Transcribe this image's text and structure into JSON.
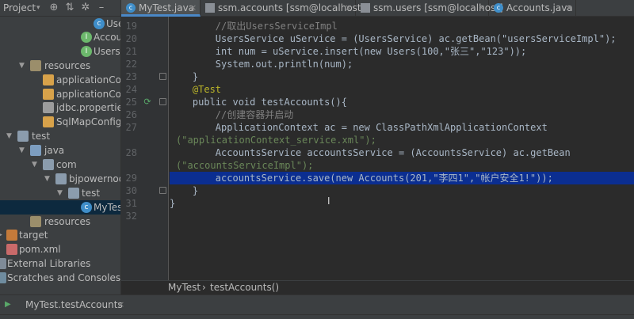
{
  "project_header": {
    "label": "Project",
    "caret": "▾"
  },
  "tree": [
    {
      "label": "Use",
      "icon": "class-icon",
      "name": "tree-item-users-class"
    },
    {
      "label": "Accoun",
      "icon": "interface-icon",
      "name": "tree-item-accounts-interface"
    },
    {
      "label": "UsersSe",
      "icon": "interface-icon",
      "name": "tree-item-users-service"
    },
    {
      "label": "resources",
      "icon": "resources-folder-icon",
      "name": "tree-item-resources"
    },
    {
      "label": "applicationConte",
      "icon": "xml-icon",
      "name": "tree-item-application-context"
    },
    {
      "label": "applicationConte",
      "icon": "xml-icon",
      "name": "tree-item-application-context-service"
    },
    {
      "label": "jdbc.properties",
      "icon": "properties-icon",
      "name": "tree-item-jdbc-properties"
    },
    {
      "label": "SqlMapConfig.xm",
      "icon": "xml-icon",
      "name": "tree-item-sqlmapconfig"
    },
    {
      "label": "test",
      "icon": "folder-icon",
      "name": "tree-item-test"
    },
    {
      "label": "java",
      "icon": "source-folder-icon",
      "name": "tree-item-java"
    },
    {
      "label": "com",
      "icon": "folder-icon",
      "name": "tree-item-com"
    },
    {
      "label": "bjpowernode",
      "icon": "folder-icon",
      "name": "tree-item-bjpowernode"
    },
    {
      "label": "test",
      "icon": "folder-icon",
      "name": "tree-item-test-package"
    },
    {
      "label": "MyTest",
      "icon": "class-icon",
      "name": "tree-item-mytest"
    },
    {
      "label": "resources",
      "icon": "resources-folder-icon",
      "name": "tree-item-test-resources"
    },
    {
      "label": "target",
      "icon": "target-folder-icon",
      "name": "tree-item-target"
    },
    {
      "label": "pom.xml",
      "icon": "maven-icon",
      "name": "tree-item-pom"
    },
    {
      "label": "External Libraries",
      "icon": "library-icon",
      "name": "tree-item-external-libraries"
    },
    {
      "label": "Scratches and Consoles",
      "icon": "scratches-icon",
      "name": "tree-item-scratches"
    }
  ],
  "tabs": [
    {
      "label": "MyTest.java",
      "active": true
    },
    {
      "label": "ssm.accounts [ssm@localhost]",
      "active": false
    },
    {
      "label": "ssm.users [ssm@localhost]",
      "active": false
    },
    {
      "label": "Accounts.java",
      "active": false
    }
  ],
  "gutter_lines": [
    "19",
    "20",
    "21",
    "22",
    "23",
    "24",
    "25",
    "26",
    "27",
    "",
    "28",
    "",
    "29",
    "30",
    "31",
    "32"
  ],
  "code_lines": [
    "        //取出UsersServiceImpl",
    "        UsersService uService = (UsersService) ac.getBean(\"usersServiceImpl\");",
    "        int num = uService.insert(new Users(100,\"张三\",\"123\"));",
    "        System.out.println(num);",
    "    }",
    "    @Test",
    "    public void testAccounts(){",
    "        //创建容器并启动",
    "        ApplicationContext ac = new ClassPathXmlApplicationContext",
    "(\"applicationContext_service.xml\");",
    "        AccountsService accountsService = (AccountsService) ac.getBean",
    "(\"accountsServiceImpl\");",
    "        accountsService.save(new Accounts(201,\"李四1\",\"帐户安全1!\"));",
    "    }",
    "}",
    ""
  ],
  "breadcrumbs": [
    "MyTest",
    "›",
    "testAccounts()"
  ],
  "run_tab": {
    "label": "MyTest.testAccounts",
    "close": "×"
  },
  "colors": {
    "keyword": "#cc7832",
    "string": "#6a8759",
    "number": "#6897bb",
    "comment": "#808080",
    "annotation": "#bbb529",
    "highlight": "#0b2e91"
  }
}
